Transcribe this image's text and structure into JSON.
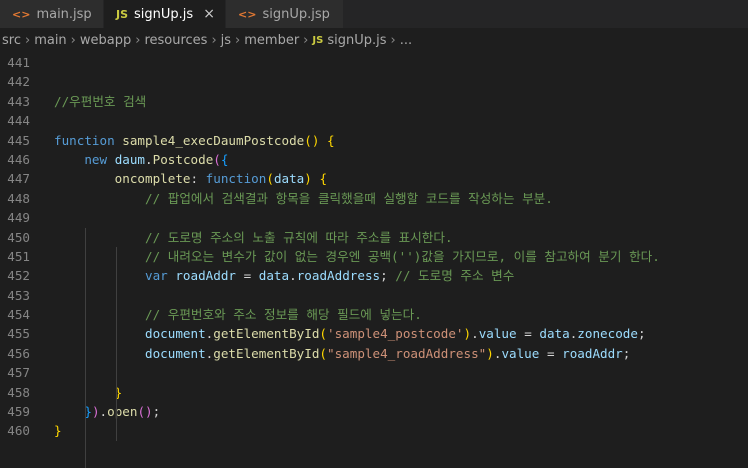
{
  "tabs": [
    {
      "icon": "<>",
      "label": "main.jsp"
    },
    {
      "icon": "JS",
      "label": "signUp.js",
      "close": "×"
    },
    {
      "icon": "<>",
      "label": "signUp.jsp"
    }
  ],
  "breadcrumb": {
    "parts": [
      "src",
      "main",
      "webapp",
      "resources",
      "js",
      "member"
    ],
    "js_icon": "JS",
    "file": "signUp.js",
    "tail": "..."
  },
  "code": {
    "line_numbers": [
      "441",
      "442",
      "443",
      "444",
      "445",
      "446",
      "447",
      "448",
      "449",
      "450",
      "451",
      "452",
      "453",
      "454",
      "455",
      "456",
      "457",
      "458",
      "459",
      "460"
    ],
    "l443": "//우편번호 검색",
    "l445_kw": "function",
    "l445_fn": "sample4_execDaumPostcode",
    "l446_new": "new",
    "l446_daum": "daum",
    "l446_pc": "Postcode",
    "l447_key": "oncomplete",
    "l447_fn": "function",
    "l447_arg": "data",
    "l448": "// 팝업에서 검색결과 항목을 클릭했을때 실행할 코드를 작성하는 부분.",
    "l450": "// 도로명 주소의 노출 규칙에 따라 주소를 표시한다.",
    "l451": "// 내려오는 변수가 값이 없는 경우엔 공백('')값을 가지므로, 이를 참고하여 분기 한다.",
    "l452_var": "var",
    "l452_name": "roadAddr",
    "l452_data": "data",
    "l452_prop": "roadAddress",
    "l452_cm": "// 도로명 주소 변수",
    "l454": "// 우편번호와 주소 정보를 해당 필드에 넣는다.",
    "doc": "document",
    "get": "getElementById",
    "value": "value",
    "l455_str": "'sample4_postcode'",
    "l455_prop": "zonecode",
    "l456_str": "\"sample4_roadAddress\"",
    "l456_rhs": "roadAddr",
    "open": "open"
  }
}
